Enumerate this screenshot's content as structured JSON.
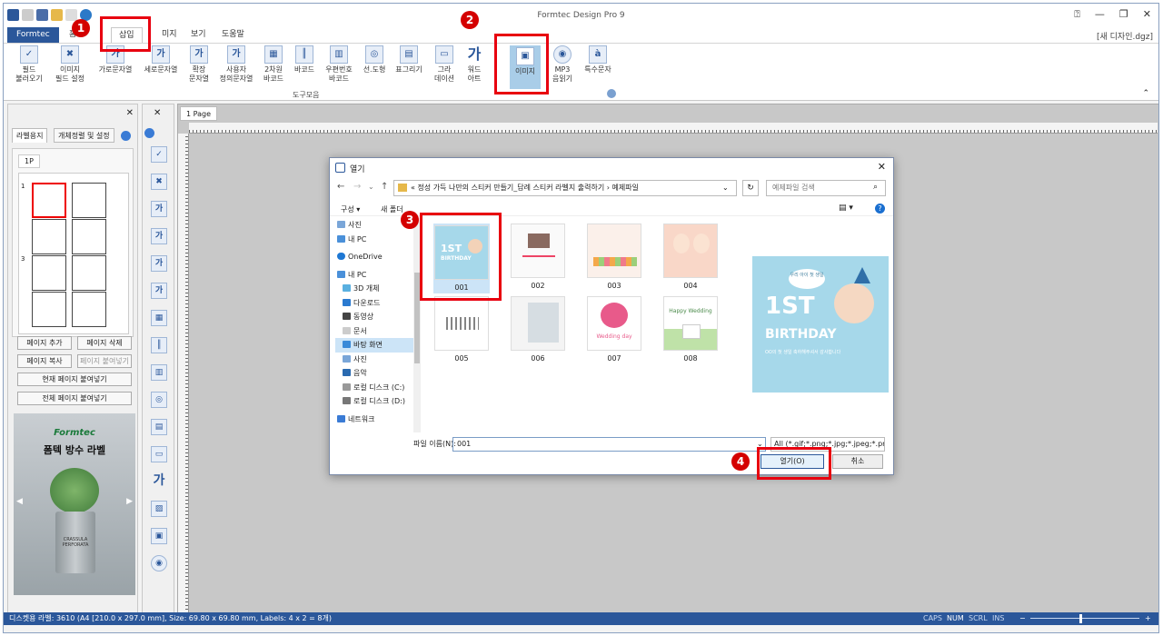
{
  "window": {
    "title": "Formtec Design Pro 9",
    "doc_label": "[새 디자인.dgz]"
  },
  "tabs": {
    "file": "Formtec",
    "home": "홈",
    "insert": "삽입",
    "view_partial": "미지",
    "view": "보기",
    "help": "도움말"
  },
  "ribbon": {
    "buttons": [
      {
        "label": "필드\n불러오기",
        "icon": "✓"
      },
      {
        "label": "이미지\n필드 설정",
        "icon": "✖"
      },
      {
        "label": "가로문자열",
        "icon": "가"
      },
      {
        "label": "세로문자열",
        "icon": "가"
      },
      {
        "label": "확장\n문자열",
        "icon": "가"
      },
      {
        "label": "사용자\n정의문자열",
        "icon": "가"
      },
      {
        "label": "2차원\n바코드",
        "icon": "▦"
      },
      {
        "label": "바코드",
        "icon": "║"
      },
      {
        "label": "우편번호\n바코드",
        "icon": "▥"
      },
      {
        "label": "선.도형",
        "icon": "◎"
      },
      {
        "label": "표그리기",
        "icon": "▤"
      },
      {
        "label": "그라\n데이션",
        "icon": "▭"
      },
      {
        "label": "워드\n아트",
        "icon": "가"
      },
      {
        "label": "이미지",
        "icon": "▣"
      },
      {
        "label": "MP3\n음읽기",
        "icon": "◉"
      },
      {
        "label": "특수문자",
        "icon": "à"
      }
    ],
    "group_label": "도구모음"
  },
  "left_panel": {
    "tabs": [
      "라벨용지",
      "개체정렬 및 설정"
    ],
    "page_tab": "1P",
    "row_numbers": [
      "1",
      "3"
    ],
    "buttons": {
      "add_page": "페이지 추가",
      "delete_page": "페이지 삭제",
      "copy_page": "페이지 복사",
      "paste_page": "페이지 붙여넣기",
      "paste_current": "현재 페이지 붙여넣기",
      "paste_all": "전체 페이지 붙여넣기"
    },
    "ad": {
      "brand": "Formtec",
      "title": "폼텍 방수 라벨",
      "pot_text": "CRASSULA PERFORATA"
    }
  },
  "workspace": {
    "page_tab": "1 Page"
  },
  "dialog": {
    "title": "열기",
    "path": "«  정성 가득 나만의 스티커 만들기_답례 스티커 라벨지 출력하기  ›  예제파일",
    "search_placeholder": "예제파일 검색",
    "organize": "구성 ▾",
    "new_folder": "새 폴더",
    "nav": [
      "사진",
      "내 PC",
      "OneDrive",
      "내 PC",
      "3D 개체",
      "다운로드",
      "동영상",
      "문서",
      "바탕 화면",
      "사진",
      "음악",
      "로컬 디스크 (C:)",
      "로컬 디스크 (D:)",
      "네트워크"
    ],
    "files": [
      "001",
      "002",
      "003",
      "004",
      "005",
      "006",
      "007",
      "008"
    ],
    "preview": {
      "title_1": "1ST",
      "title_2": "BIRTHDAY",
      "subtitle": "OO의 첫 생일 축하해주셔서 감사합니다",
      "bubble": "우리 아이 첫 생일"
    },
    "thumb_text": {
      "t001_1": "1ST",
      "t001_2": "BIRTHDAY",
      "t007": "Wedding day",
      "t008": "Happy Wedding"
    },
    "filename_label": "파일 이름(N):",
    "filename_value": "001",
    "filter": "All (*.gif;*.png;*.jpg;*.jpeg;*.pn",
    "open_button": "열기(O)",
    "cancel_button": "취소"
  },
  "annotations": [
    "1",
    "2",
    "3",
    "4"
  ],
  "status": {
    "text": "디스켓용 라벨: 3610 (A4 [210.0 x 297.0 mm], Size: 69.80 x 69.80 mm, Labels: 4 x 2 = 8개)",
    "indicators": [
      "CAPS",
      "NUM",
      "SCRL",
      "INS"
    ]
  },
  "colors": {
    "accent": "#2b579a",
    "highlight": "#e8000f",
    "sky": "#a6d8ea"
  }
}
